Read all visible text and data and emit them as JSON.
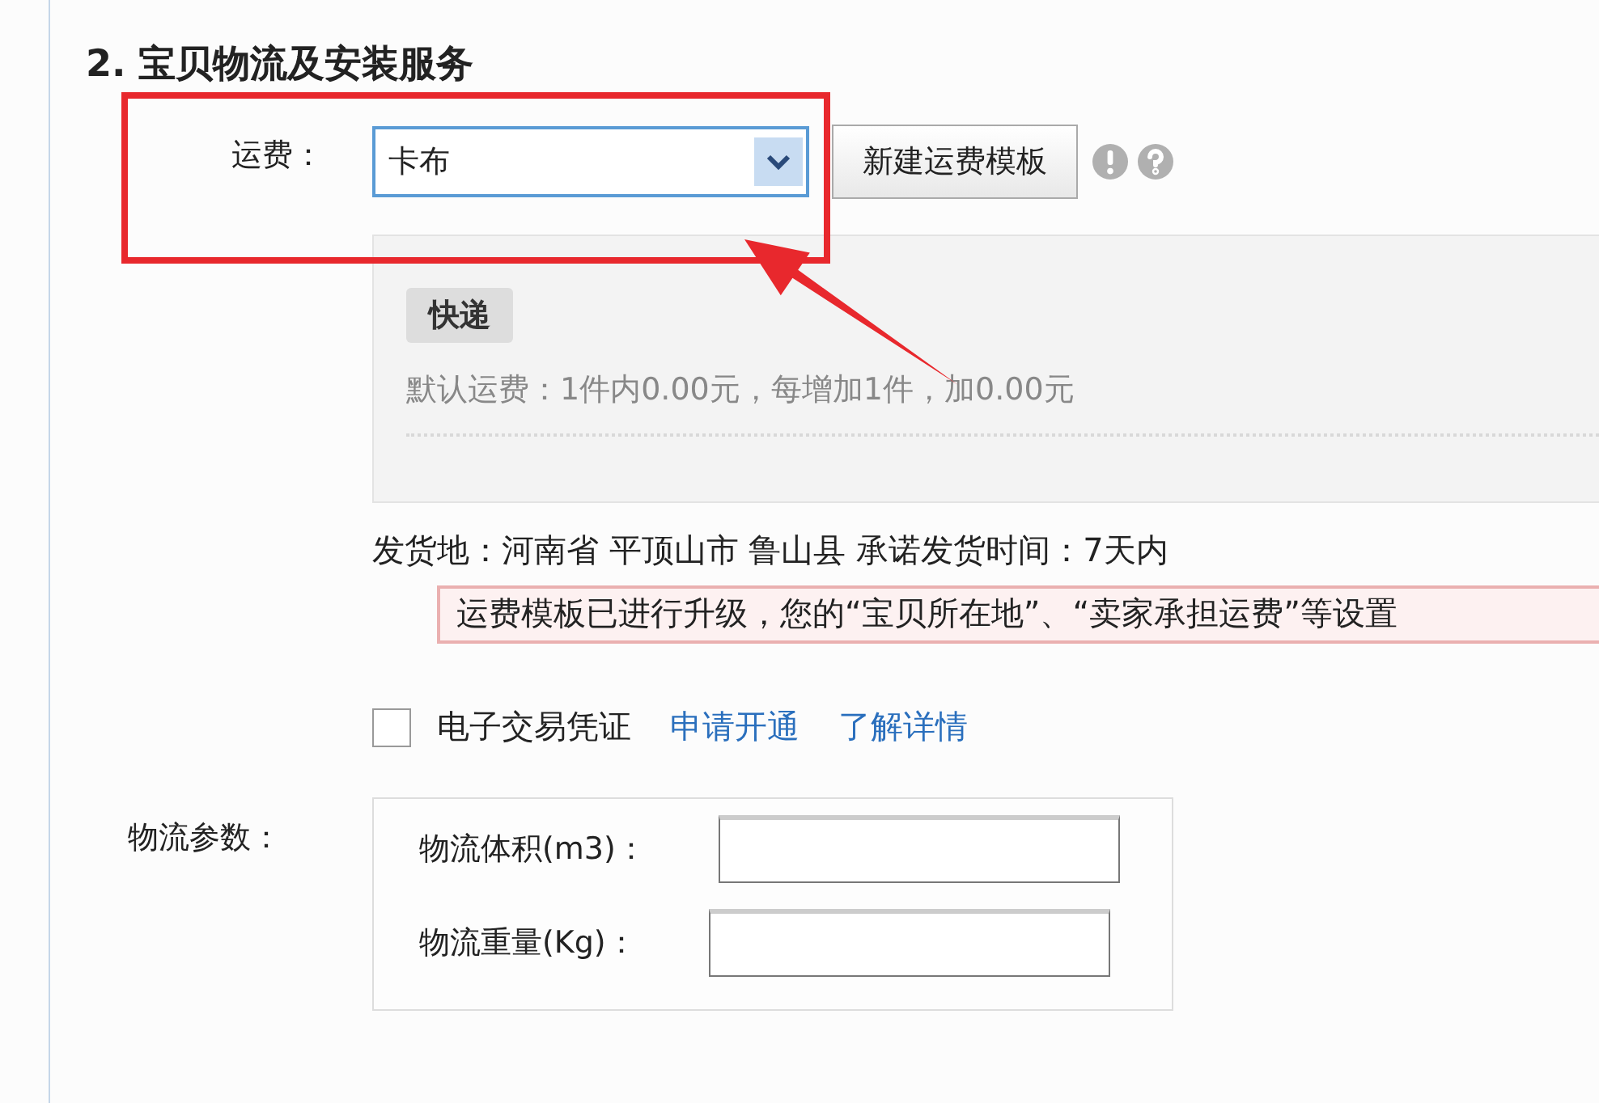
{
  "section": {
    "title": "2. 宝贝物流及安装服务"
  },
  "shipping_fee": {
    "label": "运费：",
    "select_value": "卡布",
    "new_template_button": "新建运费模板"
  },
  "template": {
    "tag": "快递",
    "default_fee": "默认运费：1件内0.00元，每增加1件，加0.00元"
  },
  "ship_from": "发货地：河南省 平顶山市 鲁山县 承诺发货时间：7天内",
  "notice": "运费模板已进行升级，您的“宝贝所在地”、“卖家承担运费”等设置",
  "e_voucher": {
    "checked": false,
    "label": "电子交易凭证",
    "links": [
      "申请开通",
      "了解详情"
    ]
  },
  "logistics": {
    "label": "物流参数：",
    "fields": [
      {
        "label": "物流体积(m3)："
      },
      {
        "label": "物流重量(Kg)："
      }
    ]
  }
}
